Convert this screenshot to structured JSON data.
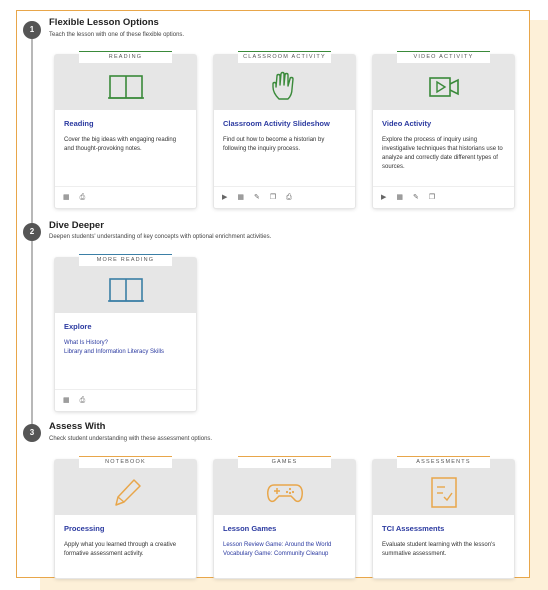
{
  "sections": [
    {
      "number": "1",
      "title": "Flexible Lesson Options",
      "description": "Teach the lesson with one of these flexible options.",
      "cards": [
        {
          "tag": "READING",
          "title": "Reading",
          "text": "Cover the big ideas with engaging reading and thought-provoking notes.",
          "icon": "book-icon",
          "accent": "#3a8a3a",
          "foot_icons": [
            "calendar-icon",
            "print-icon"
          ]
        },
        {
          "tag": "CLASSROOM ACTIVITY",
          "title": "Classroom Activity Slideshow",
          "text": "Find out how to become a historian by following the inquiry process.",
          "icon": "hand-icon",
          "accent": "#3a8a3a",
          "foot_icons": [
            "play-icon",
            "calendar-icon",
            "edit-icon",
            "copy-icon",
            "print-icon"
          ]
        },
        {
          "tag": "VIDEO ACTIVITY",
          "title": "Video Activity",
          "text": "Explore the process of inquiry using investigative techniques that historians use to analyze and correctly date different types of sources.",
          "icon": "video-icon",
          "accent": "#3a8a3a",
          "foot_icons": [
            "play-icon",
            "calendar-icon",
            "edit-icon",
            "copy-icon"
          ]
        }
      ]
    },
    {
      "number": "2",
      "title": "Dive Deeper",
      "description": "Deepen students' understanding of key concepts with optional enrichment activities.",
      "cards": [
        {
          "tag": "MORE READING",
          "title": "Explore",
          "links": [
            "What Is History?",
            "Library and Information Literacy Skills"
          ],
          "icon": "book-icon",
          "accent": "#3b7fa6",
          "foot_icons": [
            "calendar-icon",
            "print-icon"
          ]
        }
      ]
    },
    {
      "number": "3",
      "title": "Assess With",
      "description": "Check student understanding with these assessment options.",
      "cards": [
        {
          "tag": "NOTEBOOK",
          "title": "Processing",
          "text": "Apply what you learned through a creative formative assessment activity.",
          "icon": "pencil-icon",
          "accent": "#e8a64a"
        },
        {
          "tag": "GAMES",
          "title": "Lesson Games",
          "links": [
            "Lesson Review Game: Around the World",
            "Vocabulary Game: Community Cleanup"
          ],
          "icon": "gamepad-icon",
          "accent": "#e8a64a"
        },
        {
          "tag": "ASSESSMENTS",
          "title": "TCI Assessments",
          "text": "Evaluate student learning with the lesson's summative assessment.",
          "icon": "checklist-icon",
          "accent": "#e8a64a"
        }
      ]
    }
  ],
  "glyphs": {
    "play": "▶",
    "calendar": "▦",
    "edit": "✎",
    "copy": "❐",
    "print": "⎙"
  }
}
